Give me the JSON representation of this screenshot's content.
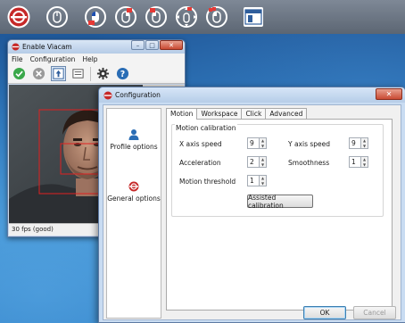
{
  "toolbar": {
    "buttons": [
      {
        "icon": "enable-viacam-logo-icon"
      },
      {
        "icon": "mouse-icon"
      },
      {
        "icon": "mouse-left-click-icon"
      },
      {
        "icon": "mouse-right-click-icon"
      },
      {
        "icon": "mouse-middle-click-icon"
      },
      {
        "icon": "mouse-drag-icon"
      },
      {
        "icon": "mouse-double-click-icon"
      },
      {
        "icon": "show-window-icon"
      }
    ]
  },
  "viacam_window": {
    "title": "Enable Viacam",
    "menu": [
      "File",
      "Configuration",
      "Help"
    ],
    "tools": [
      "check-icon",
      "disable-icon",
      "dwell-icon",
      "keyboard-icon",
      "settings-gear-icon",
      "help-icon"
    ],
    "status": "30 fps (good)"
  },
  "config_window": {
    "title": "Configuration",
    "sidebar": [
      {
        "label": "Profile options",
        "icon": "user-profile-icon"
      },
      {
        "label": "General options",
        "icon": "enable-viacam-logo-icon"
      }
    ],
    "tabs": [
      "Motion",
      "Workspace",
      "Click",
      "Advanced"
    ],
    "active_tab": "Motion",
    "group_title": "Motion calibration",
    "fields": {
      "x_speed": {
        "label": "X axis speed",
        "value": "9"
      },
      "y_speed": {
        "label": "Y axis speed",
        "value": "9"
      },
      "acceleration": {
        "label": "Acceleration",
        "value": "2"
      },
      "smoothness": {
        "label": "Smoothness",
        "value": "1"
      },
      "motion_threshold": {
        "label": "Motion threshold",
        "value": "1"
      }
    },
    "assisted_calibration": "Assisted calibration",
    "ok": "OK",
    "cancel": "Cancel"
  }
}
